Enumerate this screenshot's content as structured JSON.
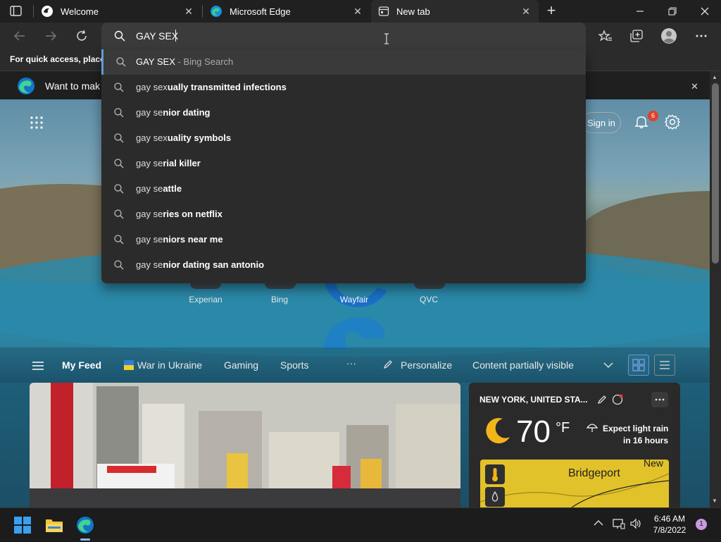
{
  "tabs": [
    {
      "title": "Welcome",
      "icon": "edge-welcome-icon"
    },
    {
      "title": "Microsoft Edge",
      "icon": "edge-icon"
    },
    {
      "title": "New tab",
      "icon": "new-tab-icon"
    }
  ],
  "new_tab_symbol": "+",
  "address_bar": {
    "value": "GAY SEX"
  },
  "suggestions": [
    {
      "typed": "GAY SEX",
      "completion": "",
      "suffix": " - Bing Search"
    },
    {
      "typed": "gay sex",
      "completion": "ually transmitted infections"
    },
    {
      "typed": "gay se",
      "completion": "nior dating"
    },
    {
      "typed": "gay sex",
      "completion": "uality symbols"
    },
    {
      "typed": "gay se",
      "completion": "rial killer"
    },
    {
      "typed": "gay se",
      "completion": "attle"
    },
    {
      "typed": "gay se",
      "completion": "ries on netflix"
    },
    {
      "typed": "gay se",
      "completion": "niors near me"
    },
    {
      "typed": "gay se",
      "completion": "nior dating san antonio"
    }
  ],
  "favorites_bar": {
    "text": "For quick access, place y"
  },
  "info_bar": {
    "text": "Want to mak"
  },
  "page": {
    "sign_in": "Sign in",
    "notification_count": "6",
    "quick_links": [
      "Experian",
      "Bing",
      "Wayfair",
      "QVC"
    ]
  },
  "feed": {
    "items": [
      "My Feed",
      "War in Ukraine",
      "Gaming",
      "Sports"
    ],
    "more": "···",
    "personalize": "Personalize",
    "content_visibility": "Content partially visible"
  },
  "weather": {
    "location": "NEW YORK, UNITED STA...",
    "temperature": "70",
    "unit": "°F",
    "forecast_line1": "Expect light rain",
    "forecast_line2": "in 16 hours",
    "map_city": "Bridgeport",
    "map_city2": "New"
  },
  "taskbar": {
    "time": "6:46 AM",
    "date": "7/8/2022",
    "notifications": "1"
  },
  "colors": {
    "accent": "#5e9bd5",
    "badge": "#e0402a",
    "weather_map": "#e2c22a"
  }
}
